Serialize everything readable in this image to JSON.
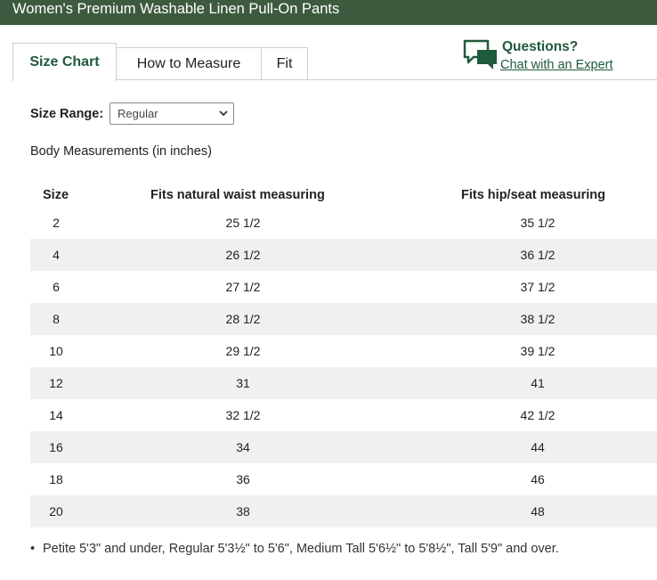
{
  "header": {
    "title": "Women's Premium Washable Linen Pull-On Pants"
  },
  "tabs": [
    {
      "label": "Size Chart",
      "active": true
    },
    {
      "label": "How to Measure",
      "active": false
    },
    {
      "label": "Fit",
      "active": false
    }
  ],
  "help": {
    "title": "Questions?",
    "link": "Chat with an Expert",
    "icon": "chat-bubbles-icon"
  },
  "size_range": {
    "label": "Size Range:",
    "selected": "Regular"
  },
  "section_title": "Body Measurements (in inches)",
  "table": {
    "headers": [
      "Size",
      "Fits natural waist measuring",
      "Fits hip/seat measuring"
    ],
    "rows": [
      [
        "2",
        "25 1/2",
        "35 1/2"
      ],
      [
        "4",
        "26 1/2",
        "36 1/2"
      ],
      [
        "6",
        "27 1/2",
        "37 1/2"
      ],
      [
        "8",
        "28 1/2",
        "38 1/2"
      ],
      [
        "10",
        "29 1/2",
        "39 1/2"
      ],
      [
        "12",
        "31",
        "41"
      ],
      [
        "14",
        "32 1/2",
        "42 1/2"
      ],
      [
        "16",
        "34",
        "44"
      ],
      [
        "18",
        "36",
        "46"
      ],
      [
        "20",
        "38",
        "48"
      ]
    ]
  },
  "notes": [
    "Petite 5'3\" and under, Regular 5'3½\" to 5'6\", Medium Tall 5'6½\" to 5'8½\", Tall 5'9\" and over."
  ],
  "colors": {
    "brand_green": "#3d5a3e",
    "accent_green": "#1f5a3c",
    "row_alt": "#f0f0f0"
  }
}
